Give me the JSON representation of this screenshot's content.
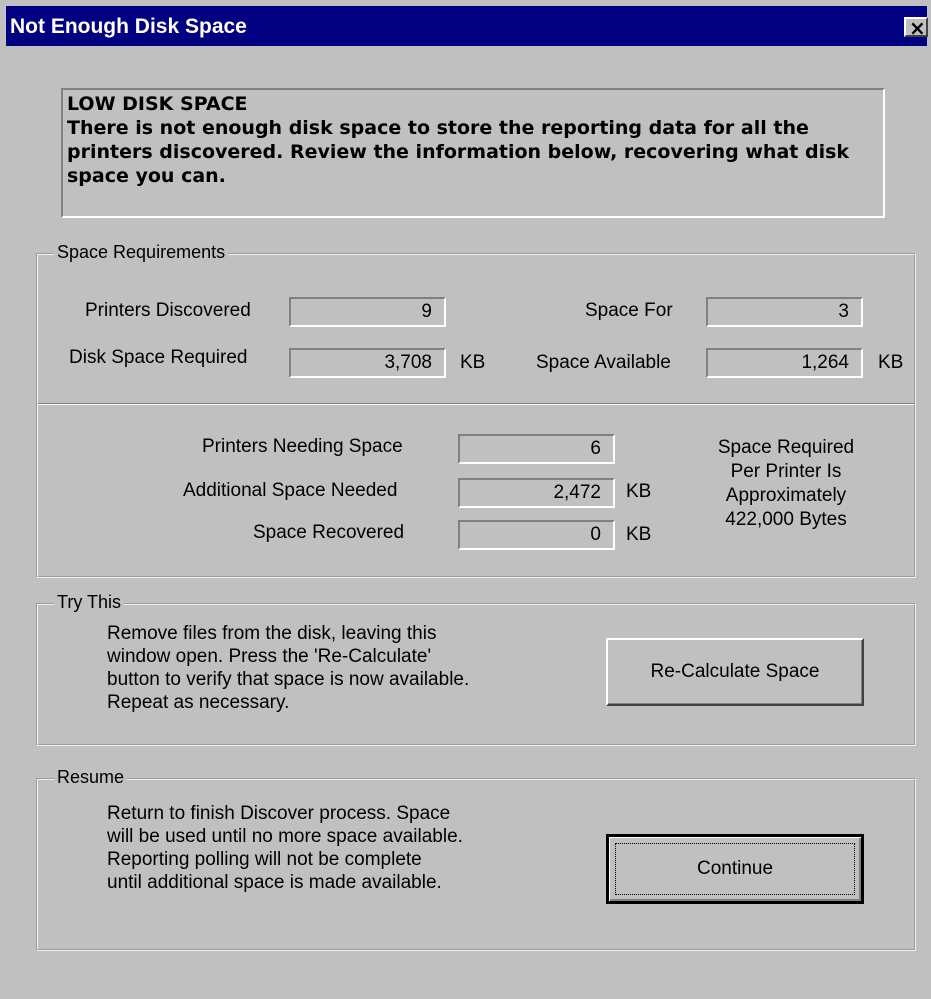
{
  "window": {
    "title": "Not Enough Disk Space",
    "close_icon": "close-icon",
    "close_glyph": "×"
  },
  "message": {
    "heading": "LOW DISK SPACE",
    "body": "There is not enough disk space to store the reporting data for all the printers discovered. Review the  information below, recovering what disk space you can."
  },
  "space_requirements": {
    "group_label": "Space Requirements",
    "printers_discovered_label": "Printers Discovered",
    "printers_discovered_value": "9",
    "space_for_label": "Space For",
    "space_for_value": "3",
    "disk_space_required_label": "Disk Space Required",
    "disk_space_required_value": "3,708",
    "space_available_label": "Space Available",
    "space_available_value": "1,264",
    "unit_kb": "KB",
    "printers_needing_label": "Printers Needing Space",
    "printers_needing_value": "6",
    "additional_needed_label": "Additional Space Needed",
    "additional_needed_value": "2,472",
    "space_recovered_label": "Space Recovered",
    "space_recovered_value": "0",
    "per_printer_note": [
      "Space Required",
      "Per Printer Is",
      "Approximately",
      "422,000 Bytes"
    ]
  },
  "try_this": {
    "group_label": "Try This",
    "lines": [
      "Remove files from the disk, leaving this",
      "window open. Press the 'Re-Calculate'",
      "button to verify that space is now available.",
      "Repeat as necessary."
    ],
    "button_label": "Re-Calculate Space"
  },
  "resume": {
    "group_label": "Resume",
    "lines": [
      "Return to finish Discover process. Space",
      "will be used until no more space available.",
      "Reporting polling will  not be complete",
      "until additional space is made available."
    ],
    "button_label": "Continue"
  }
}
